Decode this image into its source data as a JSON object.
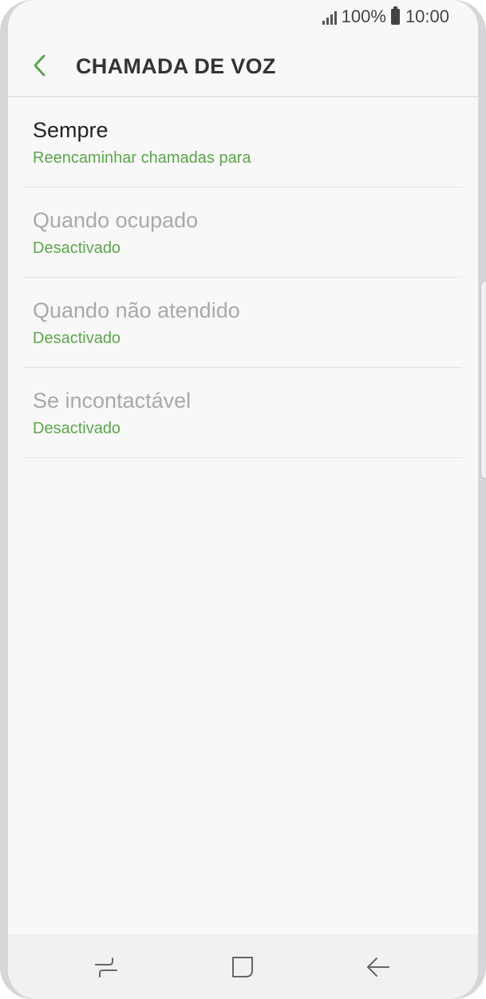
{
  "status_bar": {
    "battery": "100%",
    "time": "10:00",
    "icons": [
      "signal-icon",
      "battery-icon"
    ]
  },
  "header": {
    "title": "CHAMADA DE VOZ",
    "back_icon": "chevron-left-icon"
  },
  "colors": {
    "accent": "#5ba74a",
    "disabled_text": "#a9a9a9",
    "background": "#f8f8f8"
  },
  "list": {
    "items": [
      {
        "title": "Sempre",
        "subtitle": "Reencaminhar chamadas para"
      },
      {
        "title": "Quando ocupado",
        "subtitle": "Desactivado"
      },
      {
        "title": "Quando não atendido",
        "subtitle": "Desactivado"
      },
      {
        "title": "Se incontactável",
        "subtitle": "Desactivado"
      }
    ]
  },
  "nav_bar": {
    "icons": [
      "recent-apps-icon",
      "home-icon",
      "back-icon"
    ]
  }
}
